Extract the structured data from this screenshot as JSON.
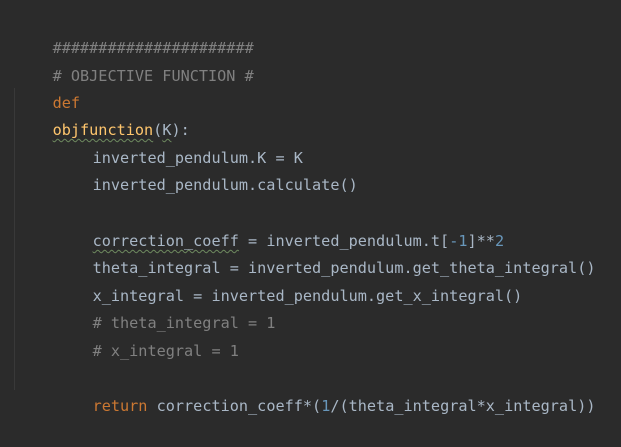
{
  "editor": {
    "lines": {
      "banner": "######################",
      "section_comment": "# OBJECTIVE FUNCTION #",
      "def_kw": "def",
      "def_name": "objfunction",
      "def_open": "(",
      "def_param": "K",
      "def_close": "):",
      "assign_k": "inverted_pendulum.K = K",
      "calculate": "inverted_pendulum.calculate()",
      "corr_name": "correction_coeff",
      "corr_mid": " = inverted_pendulum.t[",
      "corr_idx": "-1",
      "corr_pow": "]**",
      "corr_exp": "2",
      "theta_line": "theta_integral = inverted_pendulum.get_theta_integral()",
      "x_line": "x_integral = inverted_pendulum.get_x_integral()",
      "comment_theta": "# theta_integral = 1",
      "comment_x": "# x_integral = 1",
      "ret_kw": "return",
      "ret_a": " correction_coeff*(",
      "ret_one": "1",
      "ret_b": "/(theta_integral*x_integral))"
    }
  },
  "colors": {
    "background": "#2b2b2b",
    "text": "#a9b7c6",
    "comment": "#808080",
    "keyword": "#cc7832",
    "function": "#ffc66d",
    "number": "#6897bb"
  }
}
